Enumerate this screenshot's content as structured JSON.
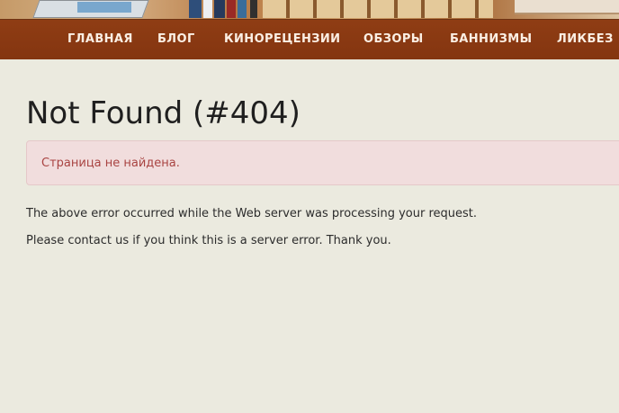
{
  "nav": {
    "items": [
      {
        "label": "ГЛАВНАЯ"
      },
      {
        "label": "БЛОГ"
      },
      {
        "label": "КИНОРЕЦЕНЗИИ"
      },
      {
        "label": "ОБЗОРЫ"
      },
      {
        "label": "БАННИЗМЫ"
      },
      {
        "label": "ЛИКБЕЗ"
      }
    ]
  },
  "error": {
    "title": "Not Found (#404)",
    "message": "Страница не найдена.",
    "paragraphs": [
      "The above error occurred while the Web server was processing your request.",
      "Please contact us if you think this is a server error. Thank you."
    ]
  },
  "colors": {
    "nav_bar": "#8a3a12",
    "page_background": "#ebeadf",
    "alert_background": "#f1dddd",
    "alert_text": "#a94442"
  }
}
